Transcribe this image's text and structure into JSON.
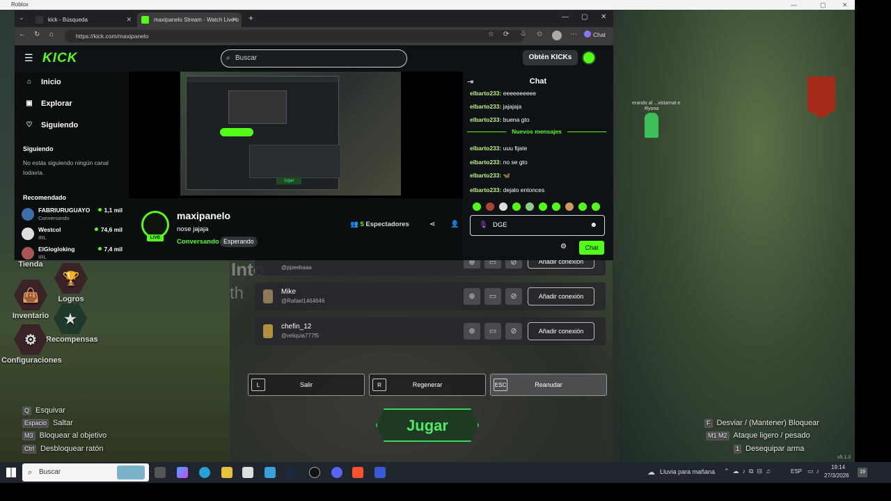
{
  "roblox": {
    "title": "Roblox"
  },
  "browser": {
    "tabs": [
      {
        "label": "kick - Búsqueda"
      },
      {
        "label": "maxipanelo Stream - Watch Live o"
      }
    ],
    "url": "https://kick.com/maxipanelo",
    "chat_button": "Chat"
  },
  "kick": {
    "search_placeholder": "Buscar",
    "get_kicks": "Obtén KICKs",
    "nav": [
      {
        "label": "Inicio"
      },
      {
        "label": "Explorar"
      },
      {
        "label": "Siguiendo"
      }
    ],
    "following_heading": "Siguiendo",
    "following_empty": "No estás siguiendo ningún canal todavía.",
    "recommended_heading": "Recomendado",
    "recommended": [
      {
        "name": "FABRIURUGUAYO",
        "sub": "Conversando",
        "viewers": "1,1 mil"
      },
      {
        "name": "Westcol",
        "sub": "IRL",
        "viewers": "74,6 mil"
      },
      {
        "name": "ElGlogloking",
        "sub": "IRL",
        "viewers": "7,4 mil"
      }
    ],
    "streamer": {
      "name": "maxipanelo",
      "live": "LIVE",
      "title": "nose jajaja",
      "category": "Conversando",
      "tag": "Esperando",
      "viewers_count": "5",
      "viewers_label": "Espectadores"
    },
    "video_overlay_button": "Jugar",
    "chat": {
      "title": "Chat",
      "messages": [
        {
          "user": "elbarto233:",
          "text": "eeeeeeeeee"
        },
        {
          "user": "elbarto233:",
          "text": "jajajaja"
        },
        {
          "user": "elbarto233:",
          "text": "buena gto"
        },
        {
          "user": "elbarto233:",
          "text": "uuu fijate"
        },
        {
          "user": "elbarto233:",
          "text": "no se gto"
        },
        {
          "user": "elbarto233:",
          "text": ""
        },
        {
          "user": "elbarto233:",
          "text": "dejalo entonces"
        }
      ],
      "new_messages": "Nuevos mensajes",
      "input_value": "DGE",
      "send_button": "Chat"
    }
  },
  "game": {
    "menu": [
      {
        "label": "Tienda"
      },
      {
        "label": "Logros"
      },
      {
        "label": "Inventario"
      },
      {
        "label": "Recompensas"
      },
      {
        "label": "Configuraciones"
      }
    ],
    "bg_text": "Into",
    "bg_text2": "th",
    "people": [
      {
        "name": "",
        "handle": "@ppeebaaa",
        "add": "Añadir conexión"
      },
      {
        "name": "Mike",
        "handle": "@Rafael1464646",
        "add": "Añadir conexión"
      },
      {
        "name": "chefin_12",
        "handle": "@reliquia777f5",
        "add": "Añadir conexión"
      }
    ],
    "actions": [
      {
        "key": "L",
        "label": "Salir"
      },
      {
        "key": "R",
        "label": "Regenerar"
      },
      {
        "key": "ESC",
        "label": "Reanudar"
      }
    ],
    "play_button": "Jugar",
    "left_binds": [
      {
        "key": "Q",
        "label": "Esquivar"
      },
      {
        "key": "Espacio",
        "label": "Saltar"
      },
      {
        "key": "M3",
        "label": "Bloquear al objetivo"
      },
      {
        "key": "Ctrl",
        "label": "Desbloquear ratón"
      }
    ],
    "right_binds": [
      {
        "key": "F",
        "label": "Desviar / (Mantener) Bloquear"
      },
      {
        "key": "M1 M2",
        "label": "Ataque ligero / pesado"
      },
      {
        "key": "1",
        "label": "Desequipar arma"
      }
    ],
    "version": "v5.1.3",
    "npc_label": "erando al ...vistarnat e",
    "npc_label2": "Ryona"
  },
  "taskbar": {
    "search": "Buscar",
    "weather": "Lluvia para mañana",
    "lang": "ESP",
    "time": "19:14",
    "date": "27/3/2026",
    "badge": "19"
  }
}
